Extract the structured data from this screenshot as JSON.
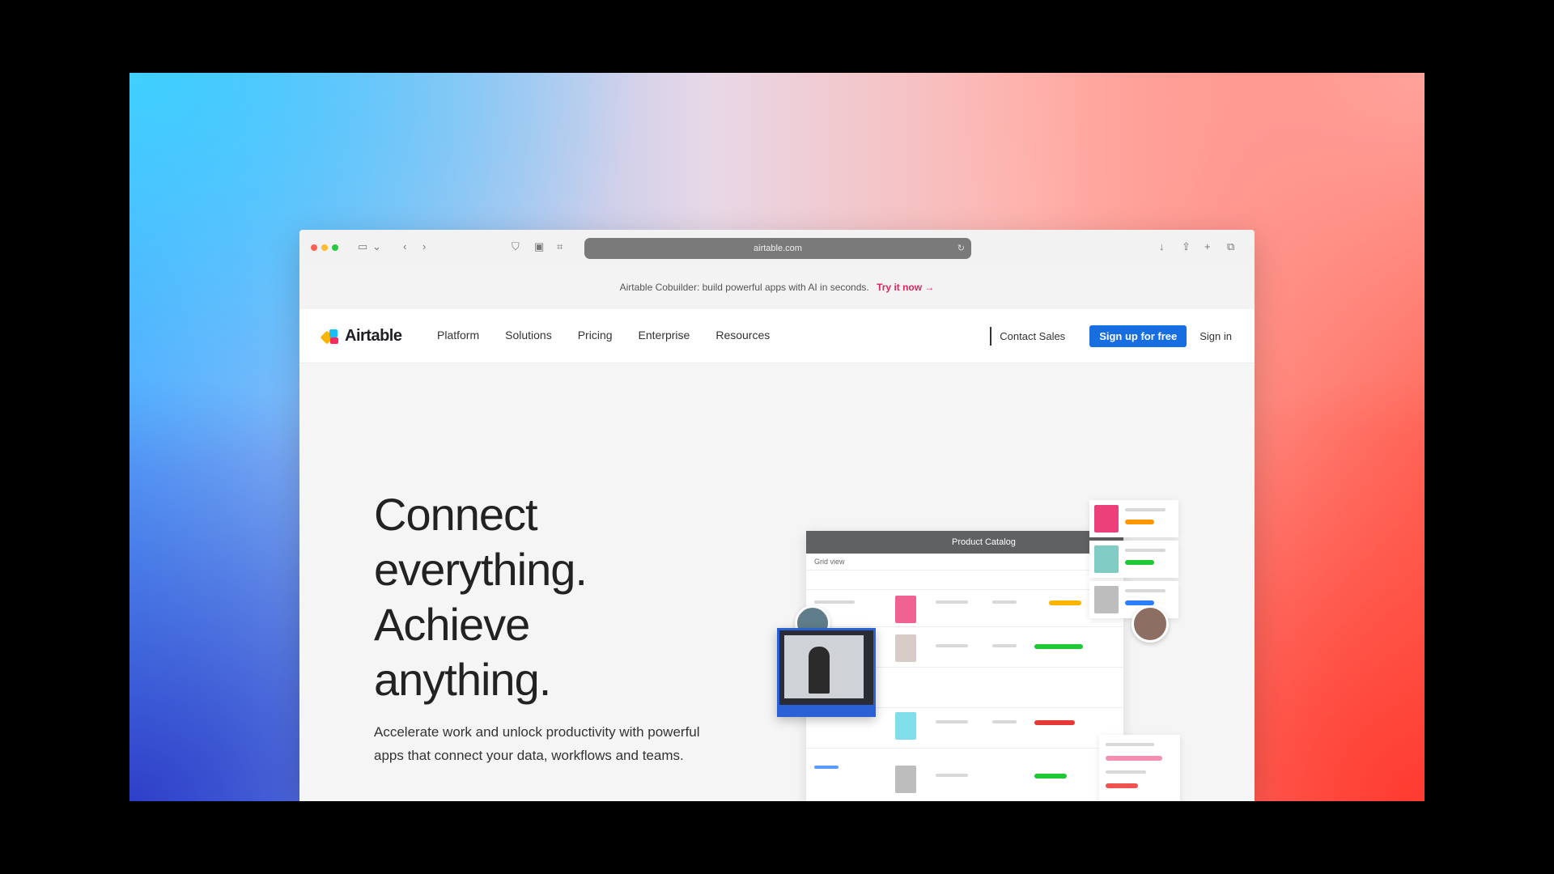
{
  "browser": {
    "url": "airtable.com",
    "toolbar_icons": [
      "sidebar-icon",
      "chevron-down-icon",
      "back-icon",
      "forward-icon",
      "shield-icon",
      "tab-icon",
      "bookmark-icon",
      "download-icon",
      "share-icon",
      "plus-icon",
      "tabs-overview-icon"
    ]
  },
  "announcement": {
    "text": "Airtable Cobuilder: build powerful apps with AI in seconds.",
    "link": "Try it now →"
  },
  "nav": {
    "logo": "Airtable",
    "links": [
      "Platform",
      "Solutions",
      "Pricing",
      "Enterprise",
      "Resources"
    ],
    "contact": "Contact Sales",
    "cta": "Sign up for free",
    "signin": "Sign in"
  },
  "hero": {
    "title_lines": [
      "Connect",
      "everything.",
      "Achieve",
      "anything."
    ],
    "subtitle": "Accelerate work and unlock productivity with powerful apps that connect your data, workflows and teams."
  },
  "illustration": {
    "window_title": "Product Catalog",
    "tab_label": "Grid view"
  },
  "colors": {
    "cta": "#166ee1",
    "announcement_link": "#e0245e"
  }
}
